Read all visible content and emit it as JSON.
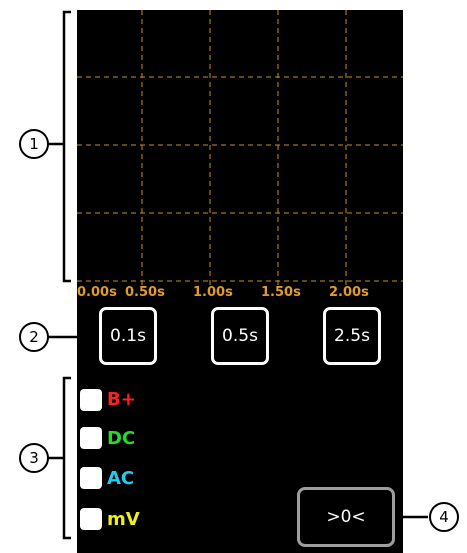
{
  "colors": {
    "screen": "#000000",
    "grid": "#c8901f",
    "tick": "#e19a2c",
    "bplus": "#ff2020",
    "dc": "#22dd22",
    "ac": "#22ccee",
    "mv": "#eeee22"
  },
  "time_axis": {
    "ticks": [
      "0.00s",
      "0.50s",
      "1.00s",
      "1.50s",
      "2.00s"
    ]
  },
  "timebase_buttons": [
    "0.1s",
    "0.5s",
    "2.5s"
  ],
  "channels": [
    {
      "label": "B+"
    },
    {
      "label": "DC"
    },
    {
      "label": "AC"
    },
    {
      "label": "mV"
    }
  ],
  "zero_button": ">0<",
  "callouts": [
    "1",
    "2",
    "3",
    "4"
  ]
}
